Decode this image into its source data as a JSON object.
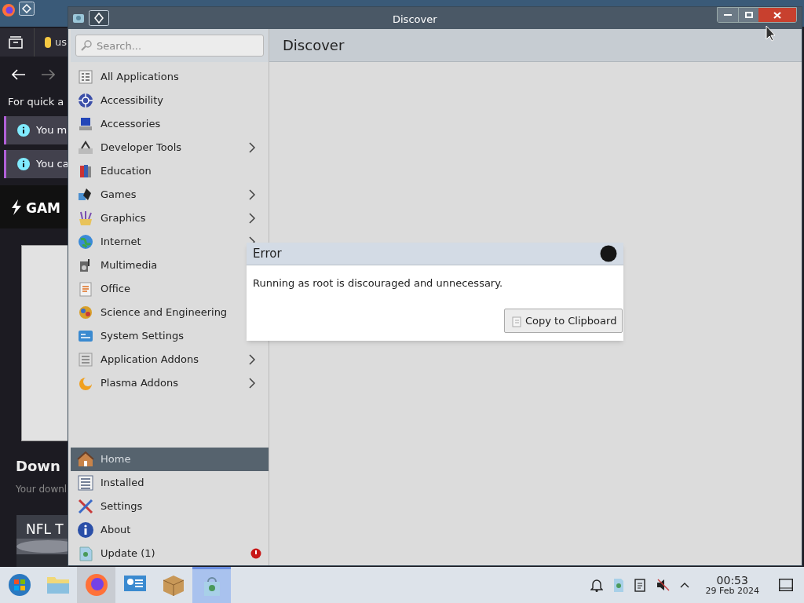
{
  "background_browser": {
    "tab_label": "us",
    "prompt": "For quick a",
    "notices": [
      "You m",
      "You ca"
    ],
    "logo": "GAM",
    "heading": "Down",
    "subheading": "Your downl",
    "card_title": "NFL T"
  },
  "window": {
    "title": "Discover"
  },
  "search": {
    "placeholder": "Search..."
  },
  "header": {
    "title": "Discover"
  },
  "categories": [
    {
      "label": "All Applications",
      "submenu": false
    },
    {
      "label": "Accessibility",
      "submenu": false
    },
    {
      "label": "Accessories",
      "submenu": false
    },
    {
      "label": "Developer Tools",
      "submenu": true
    },
    {
      "label": "Education",
      "submenu": false
    },
    {
      "label": "Games",
      "submenu": true
    },
    {
      "label": "Graphics",
      "submenu": true
    },
    {
      "label": "Internet",
      "submenu": true
    },
    {
      "label": "Multimedia",
      "submenu": false
    },
    {
      "label": "Office",
      "submenu": false
    },
    {
      "label": "Science and Engineering",
      "submenu": false
    },
    {
      "label": "System Settings",
      "submenu": false
    },
    {
      "label": "Application Addons",
      "submenu": true
    },
    {
      "label": "Plasma Addons",
      "submenu": true
    }
  ],
  "nav": [
    {
      "label": "Home",
      "selected": true,
      "alert": false
    },
    {
      "label": "Installed",
      "selected": false,
      "alert": false
    },
    {
      "label": "Settings",
      "selected": false,
      "alert": false
    },
    {
      "label": "About",
      "selected": false,
      "alert": false
    },
    {
      "label": "Update (1)",
      "selected": false,
      "alert": true
    }
  ],
  "dialog": {
    "title": "Error",
    "message": "Running as root is discouraged and unnecessary.",
    "button": "Copy to Clipboard"
  },
  "taskbar": {
    "apps": [
      {
        "selected": false
      },
      {
        "selected": false
      },
      {
        "selected": true
      },
      {
        "selected": false
      },
      {
        "selected": false
      },
      {
        "selected": true
      }
    ],
    "time": "00:53",
    "date": "29 Feb 2024"
  }
}
